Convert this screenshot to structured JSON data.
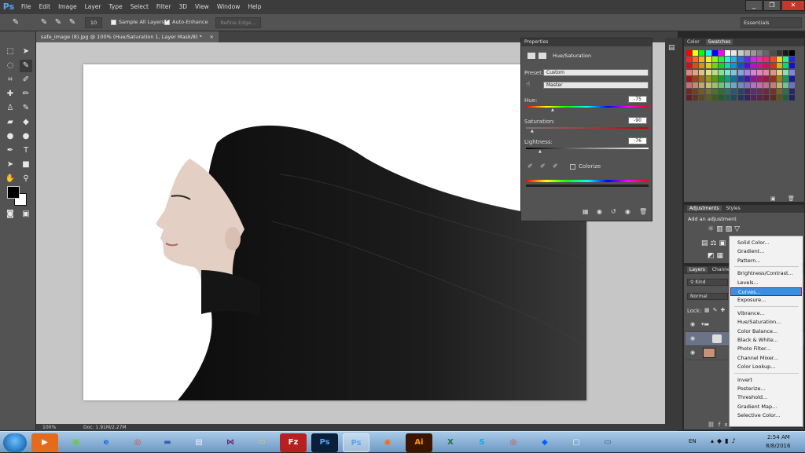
{
  "app": {
    "logo": "Ps"
  },
  "menu": [
    "File",
    "Edit",
    "Image",
    "Layer",
    "Type",
    "Select",
    "Filter",
    "3D",
    "View",
    "Window",
    "Help"
  ],
  "window_controls": {
    "minimize": "_",
    "restore": "❐",
    "close": "✕"
  },
  "options_bar": {
    "brush_size": "10",
    "sample_all_layers": "Sample All Layers",
    "auto_enhance": "Auto-Enhance",
    "refine_edge": "Refine Edge...",
    "workspace": "Essentials"
  },
  "document_tab": {
    "title": "safe_image (8).jpg @ 100% (Hue/Saturation 1, Layer Mask/8) *",
    "close": "×"
  },
  "status": {
    "zoom": "100%",
    "doc": "Doc: 1.91M/2.27M"
  },
  "properties": {
    "tab": "Properties",
    "title": "Hue/Saturation",
    "preset_label": "Preset:",
    "preset_value": "Custom",
    "channel_value": "Master",
    "hue_label": "Hue:",
    "hue_value": "-75",
    "saturation_label": "Saturation:",
    "saturation_value": "-90",
    "lightness_label": "Lightness:",
    "lightness_value": "-76",
    "colorize_label": "Colorize"
  },
  "swatches_panel": {
    "tab_color": "Color",
    "tab_swatches": "Swatches"
  },
  "adjustments_panel": {
    "tab_adjustments": "Adjustments",
    "tab_styles": "Styles",
    "heading": "Add an adjustment"
  },
  "layers_panel": {
    "tab_layers": "Layers",
    "tab_channels": "Channels",
    "kind": "Kind",
    "blend": "Normal",
    "lock": "Lock:"
  },
  "context_menu": {
    "groups": [
      [
        "Solid Color...",
        "Gradient...",
        "Pattern..."
      ],
      [
        "Brightness/Contrast...",
        "Levels...",
        "Curves...",
        "Exposure..."
      ],
      [
        "Vibrance...",
        "Hue/Saturation...",
        "Color Balance...",
        "Black & White...",
        "Photo Filter...",
        "Channel Mixer...",
        "Color Lookup..."
      ],
      [
        "Invert",
        "Posterize...",
        "Threshold...",
        "Gradient Map...",
        "Selective Color..."
      ]
    ],
    "highlighted": "Curves..."
  },
  "taskbar": {
    "lang": "EN",
    "time": "2:54 AM",
    "date": "8/8/2016"
  },
  "colors": {
    "accent": "#3a8ee6",
    "highlight_border": "#b01030"
  }
}
